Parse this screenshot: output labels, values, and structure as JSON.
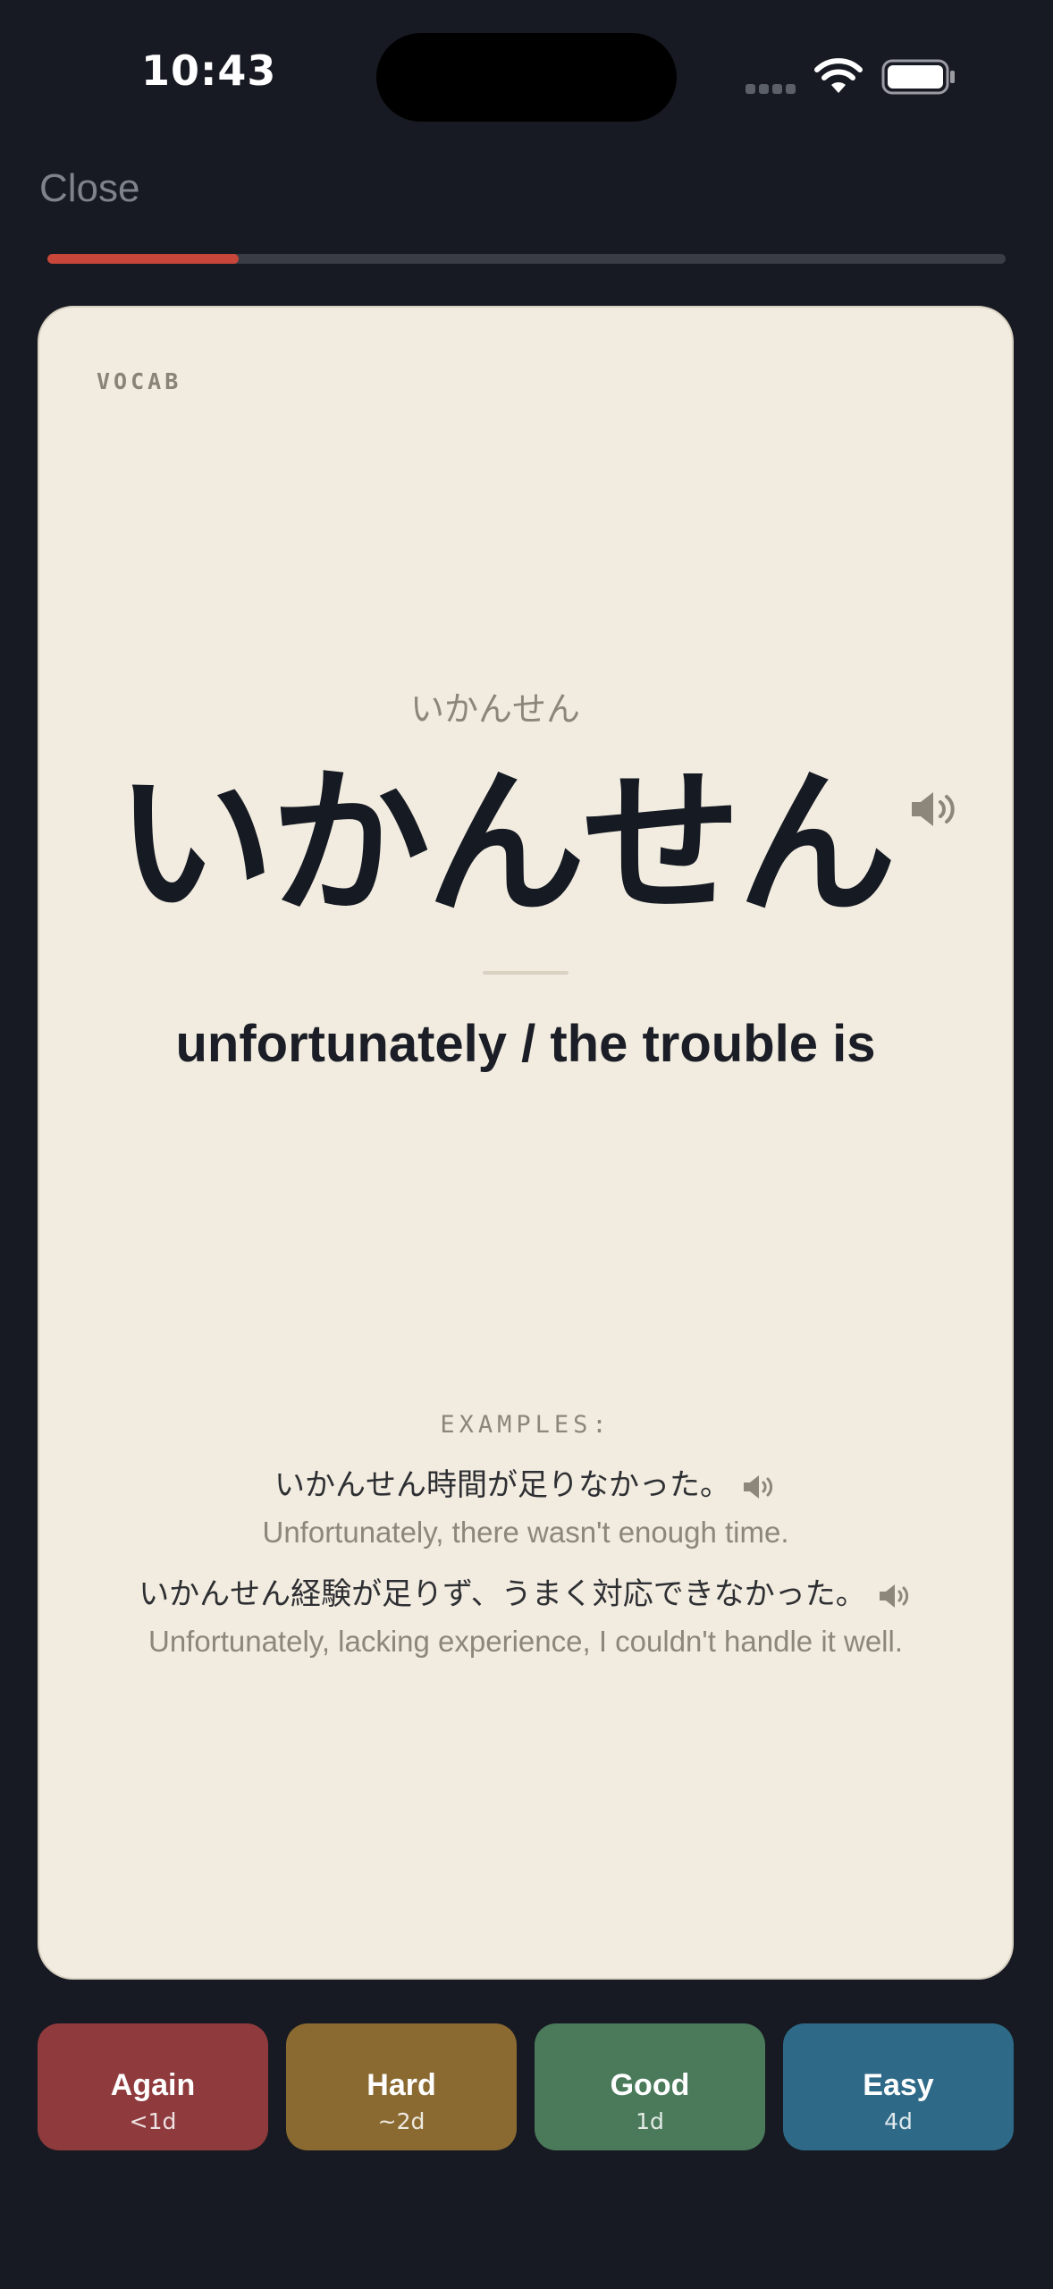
{
  "status_bar": {
    "time": "10:43"
  },
  "top_bar": {
    "close_label": "Close",
    "progress_fraction": 0.2
  },
  "card": {
    "type_tag": "VOCAB",
    "reading": "いかんせん",
    "term": "いかんせん",
    "meaning": "unfortunately / the trouble is",
    "examples_label": "EXAMPLES:",
    "examples": [
      {
        "japanese": "いかんせん時間が足りなかった。",
        "english": "Unfortunately, there wasn't enough time."
      },
      {
        "japanese": "いかんせん経験が足りず、うまく対応できなかった。",
        "english": "Unfortunately, lacking experience, I couldn't handle it well."
      }
    ]
  },
  "ratings": [
    {
      "label": "Again",
      "interval": "<1d",
      "color": "#8f3a3c"
    },
    {
      "label": "Hard",
      "interval": "~2d",
      "color": "#8a6a30"
    },
    {
      "label": "Good",
      "interval": "1d",
      "color": "#4a7a5a"
    },
    {
      "label": "Easy",
      "interval": "4d",
      "color": "#2e6a88"
    }
  ],
  "colors": {
    "background": "#171a22",
    "card": "#f2ece0",
    "accent_progress": "#c8463a"
  },
  "icons": [
    "speaker-icon",
    "wifi-icon",
    "battery-icon",
    "cellular-signal-icon"
  ]
}
